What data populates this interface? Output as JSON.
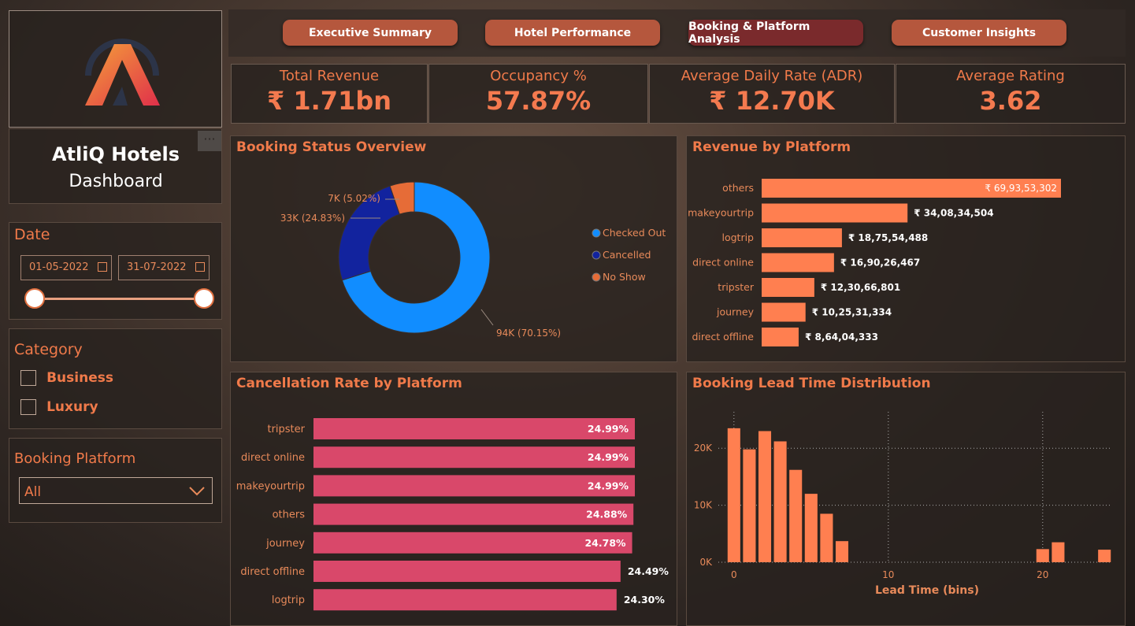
{
  "sidebar": {
    "brand_title": "AtliQ Hotels",
    "brand_subtitle": "Dashboard",
    "more_label": "···",
    "date": {
      "title": "Date",
      "start": "01-05-2022",
      "end": "31-07-2022"
    },
    "category": {
      "title": "Category",
      "options": [
        "Business",
        "Luxury"
      ]
    },
    "platform": {
      "title": "Booking Platform",
      "selected": "All"
    }
  },
  "tabs": [
    "Executive Summary",
    "Hotel Performance",
    "Booking & Platform Analysis",
    "Customer Insights"
  ],
  "active_tab": "Booking & Platform Analysis",
  "kpis": [
    {
      "label": "Total Revenue",
      "value": "₹ 1.71bn"
    },
    {
      "label": "Occupancy %",
      "value": "57.87%"
    },
    {
      "label": "Average Daily Rate (ADR)",
      "value": "₹ 12.70K"
    },
    {
      "label": "Average Rating",
      "value": "3.62"
    }
  ],
  "colors": {
    "accent": "#f07a4a",
    "bar_orange": "#ff7f50",
    "bar_pink": "#d9486a",
    "checked_out": "#118dff",
    "cancelled": "#12239e",
    "no_show": "#e66c37"
  },
  "chart_data": [
    {
      "type": "pie",
      "title": "Booking Status Overview",
      "labels": [
        "Checked Out",
        "Cancelled",
        "No Show"
      ],
      "values": [
        94,
        33,
        7
      ],
      "data_labels": [
        "94K (70.15%)",
        "33K (24.83%)",
        "7K (5.02%)"
      ],
      "legend_position": "right"
    },
    {
      "type": "bar",
      "orientation": "horizontal",
      "title": "Revenue by Platform",
      "categories": [
        "others",
        "makeyourtrip",
        "logtrip",
        "direct online",
        "tripster",
        "journey",
        "direct offline"
      ],
      "values": [
        699353302,
        340834504,
        187554488,
        169026467,
        123066801,
        102531334,
        86404333
      ],
      "data_labels": [
        "₹ 69,93,53,302",
        "₹ 34,08,34,504",
        "₹ 18,75,54,488",
        "₹ 16,90,26,467",
        "₹ 12,30,66,801",
        "₹ 10,25,31,334",
        "₹ 8,64,04,333"
      ]
    },
    {
      "type": "bar",
      "orientation": "horizontal",
      "title": "Cancellation Rate by Platform",
      "categories": [
        "tripster",
        "direct online",
        "makeyourtrip",
        "others",
        "journey",
        "direct offline",
        "logtrip"
      ],
      "values": [
        24.99,
        24.99,
        24.99,
        24.88,
        24.78,
        24.49,
        24.3
      ],
      "data_labels": [
        "24.99%",
        "24.99%",
        "24.99%",
        "24.88%",
        "24.78%",
        "24.49%",
        "24.30%"
      ]
    },
    {
      "type": "bar",
      "title": "Booking Lead Time Distribution",
      "xlabel": "Lead Time (bins)",
      "x": [
        0,
        1,
        2,
        3,
        4,
        5,
        6,
        7,
        20,
        21,
        24
      ],
      "values": [
        23500,
        19800,
        23000,
        21200,
        16200,
        12000,
        8500,
        3700,
        2300,
        3500,
        2200
      ],
      "xticks": [
        0,
        10,
        20
      ],
      "yticks": [
        "0K",
        "10K",
        "20K"
      ],
      "ylim": [
        0,
        25000
      ],
      "xlim": [
        -0.5,
        24.5
      ]
    }
  ]
}
